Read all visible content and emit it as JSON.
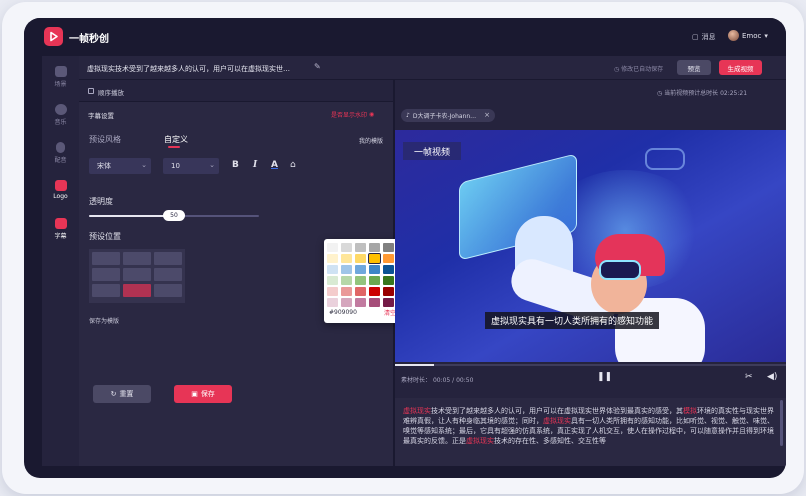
{
  "app": {
    "title": "一帧秒创"
  },
  "header": {
    "messages_label": "消息",
    "user_name": "Emoc"
  },
  "sidebar": {
    "items": [
      {
        "label": "场景",
        "icon": "scene-icon",
        "active": false
      },
      {
        "label": "音乐",
        "icon": "music-icon",
        "active": false
      },
      {
        "label": "配音",
        "icon": "voice-icon",
        "active": false
      },
      {
        "label": "Logo",
        "icon": "logo-icon",
        "active": true
      },
      {
        "label": "字幕",
        "icon": "subtitle-icon",
        "active": true
      }
    ]
  },
  "titlebar": {
    "doc_title": "虚拟现实技术受到了越来越多人的认可，用户可以在虚拟现实世…",
    "autosave": "修改已自动保存",
    "preview_label": "预览",
    "generate_label": "生成视频"
  },
  "left": {
    "sequential_play_label": "顺序播放",
    "subtitle_settings_label": "字幕设置",
    "watermark_label": "是否显示水印",
    "tabs": [
      {
        "label": "预设风格",
        "active": false
      },
      {
        "label": "自定义",
        "active": true
      }
    ],
    "my_templates_label": "我的模版",
    "font_family": "宋体",
    "font_size": "10",
    "format_bold": "B",
    "format_italic": "I",
    "format_color": "A",
    "opacity_label": "透明度",
    "opacity_value_label": "50",
    "opacity_value": 0.5,
    "position_label": "预设位置",
    "selected_position": {
      "row": 2,
      "col": 1
    },
    "save_as_template_label": "保存为模版",
    "reset_label": "重置",
    "save_label": "保存"
  },
  "color_picker": {
    "hex_value": "#909090",
    "clear_label": "清空",
    "confirm_label": "确定",
    "selected_index": 11,
    "swatches": [
      "#f2f2f2",
      "#d9d9d9",
      "#bfbfbf",
      "#a6a6a6",
      "#808080",
      "#595959",
      "#404040",
      "#0d0d0d",
      "#fff2cc",
      "#ffe699",
      "#ffd966",
      "#ffc000",
      "#ff9933",
      "#ff6600",
      "#e65c00",
      "#b34700",
      "#cfe2f3",
      "#9fc5e8",
      "#6fa8dc",
      "#3d85c6",
      "#0b5394",
      "#1c4587",
      "#073763",
      "#20124d",
      "#d9ead3",
      "#b6d7a8",
      "#93c47d",
      "#6aa84f",
      "#38761d",
      "#274e13",
      "#00b050",
      "#007a3d",
      "#f4cccc",
      "#ea9999",
      "#e06666",
      "#cc0000",
      "#990000",
      "#660000",
      "#ff0000",
      "#c00000",
      "#ead1dc",
      "#d5a6bd",
      "#c27ba0",
      "#a64d79",
      "#741b47",
      "#4c1130",
      "#ff66cc",
      "#cc3399"
    ]
  },
  "right": {
    "total_duration": "当前视频预计总时长 02:25:21",
    "music_chip": "D大调子卡农-Johann…",
    "video_brand": "一帧视频",
    "subtitle_text": "虚拟现实具有一切人类所拥有的感知功能",
    "time_label": "素材时长：",
    "time_current": "00:05",
    "time_separator": "/",
    "time_total": "00:50",
    "progress": 0.1,
    "script_segments": [
      {
        "text": "虚拟现实",
        "hl": true
      },
      {
        "text": "技术受到了越来越多人的认可，用户可以在虚拟现实世界体验到最真实的感受，其",
        "hl": false
      },
      {
        "text": "模拟",
        "hl": true
      },
      {
        "text": "环境的真实性与现实世界难辨真假，让人有种身临其境的感觉；同时，",
        "hl": false
      },
      {
        "text": "虚拟现实",
        "hl": true
      },
      {
        "text": "具有一切人类所拥有的感知功能，比如听觉、视觉、触觉、味觉、嗅觉等感知系统；最后，它具有超强的仿真系统，真正实现了人机交互，使人在操作过程中，可以随意操作并且得到环境最真实的反馈。正是",
        "hl": false
      },
      {
        "text": "虚拟现实",
        "hl": true
      },
      {
        "text": "技术的存在性、多感知性、交互性等",
        "hl": false
      }
    ]
  },
  "colors": {
    "accent": "#e73556",
    "panel": "#25233d",
    "background": "#1a1930"
  }
}
